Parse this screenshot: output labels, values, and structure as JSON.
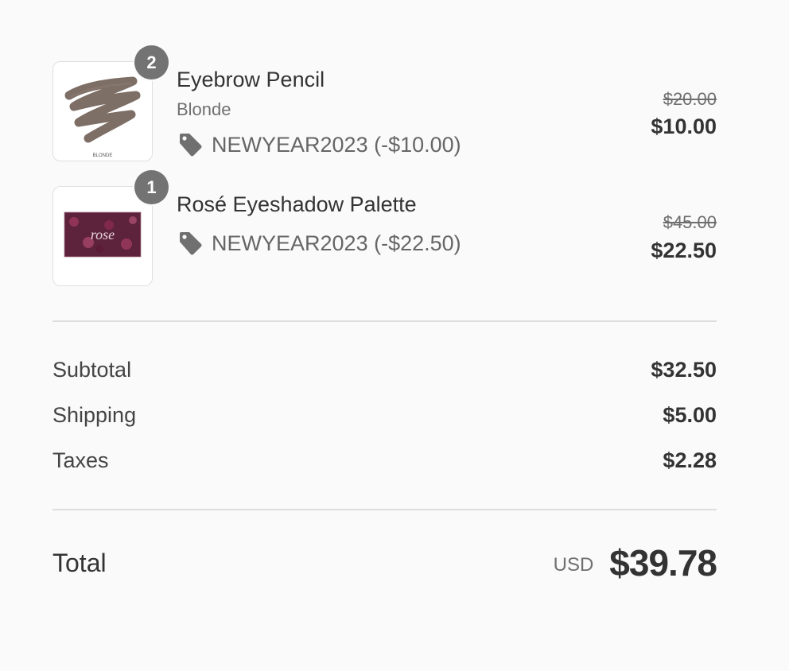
{
  "line_items": [
    {
      "quantity": "2",
      "name": "Eyebrow Pencil",
      "variant": "Blonde",
      "thumbnail_caption": "BLONDE",
      "discount_icon": "tag-icon",
      "discount_code": "NEWYEAR2023 (-$10.00)",
      "original_price": "$20.00",
      "price": "$10.00"
    },
    {
      "quantity": "1",
      "name": "Rosé Eyeshadow Palette",
      "thumbnail_caption": "rose",
      "discount_icon": "tag-icon",
      "discount_code": "NEWYEAR2023 (-$22.50)",
      "original_price": "$45.00",
      "price": "$22.50"
    }
  ],
  "summary": {
    "subtotal_label": "Subtotal",
    "subtotal_value": "$32.50",
    "shipping_label": "Shipping",
    "shipping_value": "$5.00",
    "taxes_label": "Taxes",
    "taxes_value": "$2.28"
  },
  "total": {
    "label": "Total",
    "currency": "USD",
    "value": "$39.78"
  },
  "colors": {
    "background": "#fafafa",
    "badge": "#737373",
    "text_primary": "#333333",
    "text_secondary": "#707070",
    "divider": "#dedede"
  }
}
